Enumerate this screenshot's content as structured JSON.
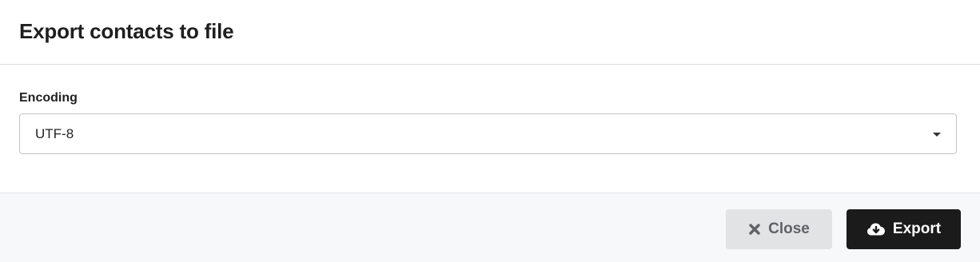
{
  "dialog": {
    "title": "Export contacts to file"
  },
  "encoding": {
    "label": "Encoding",
    "selected": "UTF-8"
  },
  "footer": {
    "close_label": "Close",
    "export_label": "Export"
  },
  "icons": {
    "close": "times-icon",
    "export": "cloud-download-icon",
    "select": "caret-down-icon"
  },
  "colors": {
    "export_button": "#1b1b1b",
    "close_button": "#e2e3e5",
    "footer_background": "#f7f8fa"
  }
}
